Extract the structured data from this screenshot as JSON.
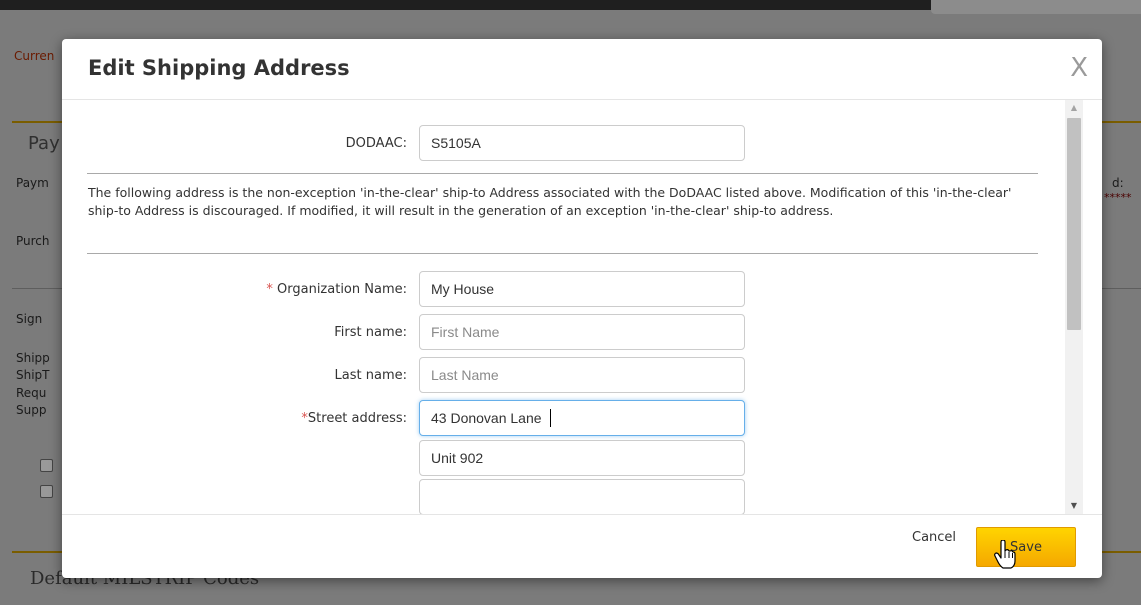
{
  "background": {
    "current_label": "Curren",
    "panel_title": "Pay",
    "panel_items": [
      "Paym",
      "Purch",
      "Sign",
      "Shipp",
      "ShipT",
      "Requ",
      "Supp"
    ],
    "right_fragment": "d:",
    "right_masked": "*****",
    "bottom_title": "Default MILSTRIP Codes"
  },
  "modal": {
    "title": "Edit Shipping Address",
    "close_glyph": "X",
    "dodaac": {
      "label": "DODAAC:",
      "value": "S5105A"
    },
    "notice": "The following address is the non-exception 'in-the-clear' ship-to Address associated with the DoDAAC listed above. Modification of this 'in-the-clear' ship-to Address is discouraged. If modified, it will result in the generation of an exception 'in-the-clear' ship-to address.",
    "fields": {
      "organization": {
        "required_mark": "*",
        "label": "Organization Name:",
        "value": "My House",
        "placeholder": ""
      },
      "first_name": {
        "label": "First name:",
        "value": "",
        "placeholder": "First Name"
      },
      "last_name": {
        "label": "Last name:",
        "value": "",
        "placeholder": "Last Name"
      },
      "street": {
        "required_mark": "*",
        "label": "Street address:",
        "value": "43 Donovan Lane",
        "placeholder": ""
      },
      "street2": {
        "value": "Unit 902",
        "placeholder": ""
      },
      "street3": {
        "value": "",
        "placeholder": ""
      }
    },
    "footer": {
      "cancel_label": "Cancel",
      "save_label": "Save"
    }
  },
  "colors": {
    "save_button": "#f8c300",
    "required": "#d9534f",
    "focus_border": "#66afe9"
  }
}
